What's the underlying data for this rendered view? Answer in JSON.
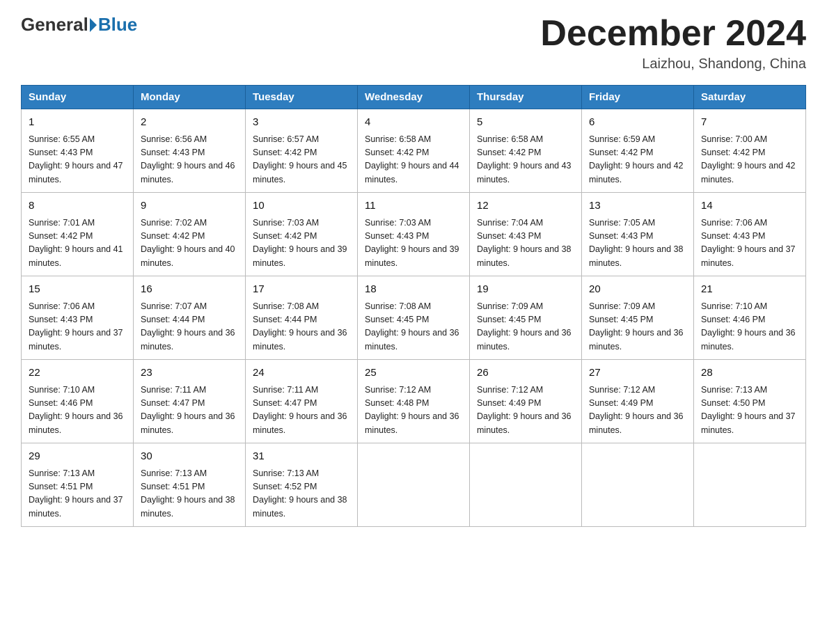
{
  "header": {
    "logo_general": "General",
    "logo_blue": "Blue",
    "month_title": "December 2024",
    "location": "Laizhou, Shandong, China"
  },
  "weekdays": [
    "Sunday",
    "Monday",
    "Tuesday",
    "Wednesday",
    "Thursday",
    "Friday",
    "Saturday"
  ],
  "weeks": [
    [
      {
        "day": "1",
        "sunrise": "Sunrise: 6:55 AM",
        "sunset": "Sunset: 4:43 PM",
        "daylight": "Daylight: 9 hours and 47 minutes."
      },
      {
        "day": "2",
        "sunrise": "Sunrise: 6:56 AM",
        "sunset": "Sunset: 4:43 PM",
        "daylight": "Daylight: 9 hours and 46 minutes."
      },
      {
        "day": "3",
        "sunrise": "Sunrise: 6:57 AM",
        "sunset": "Sunset: 4:42 PM",
        "daylight": "Daylight: 9 hours and 45 minutes."
      },
      {
        "day": "4",
        "sunrise": "Sunrise: 6:58 AM",
        "sunset": "Sunset: 4:42 PM",
        "daylight": "Daylight: 9 hours and 44 minutes."
      },
      {
        "day": "5",
        "sunrise": "Sunrise: 6:58 AM",
        "sunset": "Sunset: 4:42 PM",
        "daylight": "Daylight: 9 hours and 43 minutes."
      },
      {
        "day": "6",
        "sunrise": "Sunrise: 6:59 AM",
        "sunset": "Sunset: 4:42 PM",
        "daylight": "Daylight: 9 hours and 42 minutes."
      },
      {
        "day": "7",
        "sunrise": "Sunrise: 7:00 AM",
        "sunset": "Sunset: 4:42 PM",
        "daylight": "Daylight: 9 hours and 42 minutes."
      }
    ],
    [
      {
        "day": "8",
        "sunrise": "Sunrise: 7:01 AM",
        "sunset": "Sunset: 4:42 PM",
        "daylight": "Daylight: 9 hours and 41 minutes."
      },
      {
        "day": "9",
        "sunrise": "Sunrise: 7:02 AM",
        "sunset": "Sunset: 4:42 PM",
        "daylight": "Daylight: 9 hours and 40 minutes."
      },
      {
        "day": "10",
        "sunrise": "Sunrise: 7:03 AM",
        "sunset": "Sunset: 4:42 PM",
        "daylight": "Daylight: 9 hours and 39 minutes."
      },
      {
        "day": "11",
        "sunrise": "Sunrise: 7:03 AM",
        "sunset": "Sunset: 4:43 PM",
        "daylight": "Daylight: 9 hours and 39 minutes."
      },
      {
        "day": "12",
        "sunrise": "Sunrise: 7:04 AM",
        "sunset": "Sunset: 4:43 PM",
        "daylight": "Daylight: 9 hours and 38 minutes."
      },
      {
        "day": "13",
        "sunrise": "Sunrise: 7:05 AM",
        "sunset": "Sunset: 4:43 PM",
        "daylight": "Daylight: 9 hours and 38 minutes."
      },
      {
        "day": "14",
        "sunrise": "Sunrise: 7:06 AM",
        "sunset": "Sunset: 4:43 PM",
        "daylight": "Daylight: 9 hours and 37 minutes."
      }
    ],
    [
      {
        "day": "15",
        "sunrise": "Sunrise: 7:06 AM",
        "sunset": "Sunset: 4:43 PM",
        "daylight": "Daylight: 9 hours and 37 minutes."
      },
      {
        "day": "16",
        "sunrise": "Sunrise: 7:07 AM",
        "sunset": "Sunset: 4:44 PM",
        "daylight": "Daylight: 9 hours and 36 minutes."
      },
      {
        "day": "17",
        "sunrise": "Sunrise: 7:08 AM",
        "sunset": "Sunset: 4:44 PM",
        "daylight": "Daylight: 9 hours and 36 minutes."
      },
      {
        "day": "18",
        "sunrise": "Sunrise: 7:08 AM",
        "sunset": "Sunset: 4:45 PM",
        "daylight": "Daylight: 9 hours and 36 minutes."
      },
      {
        "day": "19",
        "sunrise": "Sunrise: 7:09 AM",
        "sunset": "Sunset: 4:45 PM",
        "daylight": "Daylight: 9 hours and 36 minutes."
      },
      {
        "day": "20",
        "sunrise": "Sunrise: 7:09 AM",
        "sunset": "Sunset: 4:45 PM",
        "daylight": "Daylight: 9 hours and 36 minutes."
      },
      {
        "day": "21",
        "sunrise": "Sunrise: 7:10 AM",
        "sunset": "Sunset: 4:46 PM",
        "daylight": "Daylight: 9 hours and 36 minutes."
      }
    ],
    [
      {
        "day": "22",
        "sunrise": "Sunrise: 7:10 AM",
        "sunset": "Sunset: 4:46 PM",
        "daylight": "Daylight: 9 hours and 36 minutes."
      },
      {
        "day": "23",
        "sunrise": "Sunrise: 7:11 AM",
        "sunset": "Sunset: 4:47 PM",
        "daylight": "Daylight: 9 hours and 36 minutes."
      },
      {
        "day": "24",
        "sunrise": "Sunrise: 7:11 AM",
        "sunset": "Sunset: 4:47 PM",
        "daylight": "Daylight: 9 hours and 36 minutes."
      },
      {
        "day": "25",
        "sunrise": "Sunrise: 7:12 AM",
        "sunset": "Sunset: 4:48 PM",
        "daylight": "Daylight: 9 hours and 36 minutes."
      },
      {
        "day": "26",
        "sunrise": "Sunrise: 7:12 AM",
        "sunset": "Sunset: 4:49 PM",
        "daylight": "Daylight: 9 hours and 36 minutes."
      },
      {
        "day": "27",
        "sunrise": "Sunrise: 7:12 AM",
        "sunset": "Sunset: 4:49 PM",
        "daylight": "Daylight: 9 hours and 36 minutes."
      },
      {
        "day": "28",
        "sunrise": "Sunrise: 7:13 AM",
        "sunset": "Sunset: 4:50 PM",
        "daylight": "Daylight: 9 hours and 37 minutes."
      }
    ],
    [
      {
        "day": "29",
        "sunrise": "Sunrise: 7:13 AM",
        "sunset": "Sunset: 4:51 PM",
        "daylight": "Daylight: 9 hours and 37 minutes."
      },
      {
        "day": "30",
        "sunrise": "Sunrise: 7:13 AM",
        "sunset": "Sunset: 4:51 PM",
        "daylight": "Daylight: 9 hours and 38 minutes."
      },
      {
        "day": "31",
        "sunrise": "Sunrise: 7:13 AM",
        "sunset": "Sunset: 4:52 PM",
        "daylight": "Daylight: 9 hours and 38 minutes."
      },
      null,
      null,
      null,
      null
    ]
  ]
}
